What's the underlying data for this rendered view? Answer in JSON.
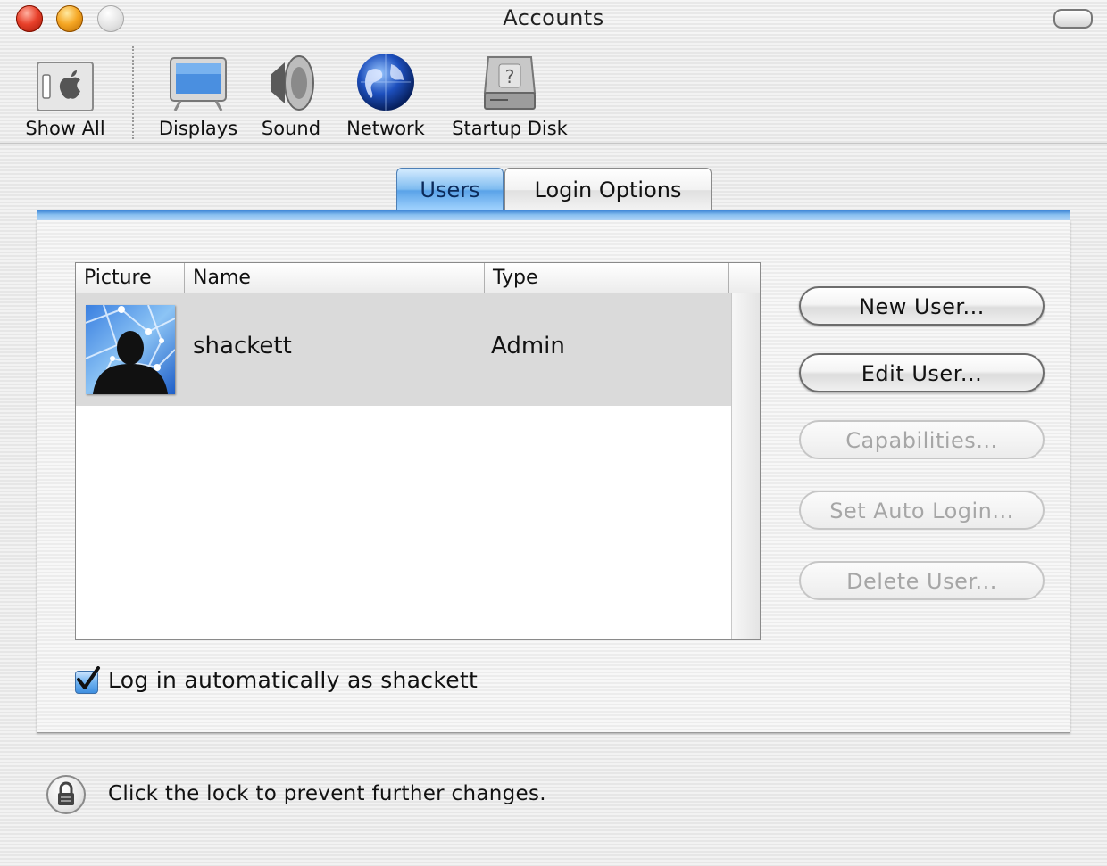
{
  "window": {
    "title": "Accounts"
  },
  "toolbar": {
    "items": [
      {
        "label": "Show All",
        "icon": "show-all-icon"
      },
      {
        "label": "Displays",
        "icon": "display-icon"
      },
      {
        "label": "Sound",
        "icon": "speaker-icon"
      },
      {
        "label": "Network",
        "icon": "globe-icon"
      },
      {
        "label": "Startup Disk",
        "icon": "hard-disk-icon"
      }
    ]
  },
  "tabs": [
    {
      "label": "Users",
      "selected": true
    },
    {
      "label": "Login Options",
      "selected": false
    }
  ],
  "users_table": {
    "columns": [
      "Picture",
      "Name",
      "Type"
    ],
    "rows": [
      {
        "picture": "user-avatar-icon",
        "name": "shackett",
        "type": "Admin",
        "selected": true
      }
    ]
  },
  "buttons": {
    "new_user": "New User...",
    "edit_user": "Edit User...",
    "capabilities": "Capabilities...",
    "set_auto_login": "Set Auto Login...",
    "delete_user": "Delete User..."
  },
  "auto_login": {
    "label": "Log in automatically as shackett",
    "checked": true
  },
  "lock": {
    "label": "Click the lock to prevent further changes.",
    "icon": "lock-icon"
  },
  "colors": {
    "tab_selected": "#6fb2f0",
    "selected_row": "#dadada",
    "disabled_text": "#a6a6a6"
  }
}
